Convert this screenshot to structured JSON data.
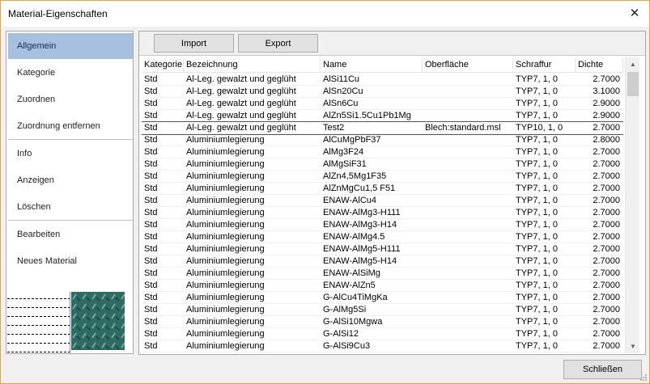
{
  "window": {
    "title": "Material-Eigenschaften",
    "close_glyph": "✕"
  },
  "sidebar": {
    "items": [
      {
        "label": "Allgemein",
        "active": true
      },
      {
        "label": "Kategorie"
      },
      {
        "label": "Zuordnen"
      },
      {
        "label": "Zuordnung entfernen"
      },
      {
        "label": "Info"
      },
      {
        "label": "Anzeigen"
      },
      {
        "label": "Löschen"
      },
      {
        "label": "Bearbeiten"
      },
      {
        "label": "Neues Material"
      }
    ]
  },
  "toolbar": {
    "import_label": "Import",
    "export_label": "Export"
  },
  "table": {
    "columns": [
      "Kategorie",
      "Bezeichnung",
      "Name",
      "Oberfläche",
      "Schraffur",
      "Dichte"
    ],
    "rows": [
      [
        "Std",
        "Al-Leg. gewalzt und geglüht",
        "AlSi11Cu",
        "",
        "TYP7, 1, 0",
        "2.7000"
      ],
      [
        "Std",
        "Al-Leg. gewalzt und geglüht",
        "AlSn20Cu",
        "",
        "TYP7, 1, 0",
        "3.1000"
      ],
      [
        "Std",
        "Al-Leg. gewalzt und geglüht",
        "AlSn6Cu",
        "",
        "TYP7, 1, 0",
        "2.9000"
      ],
      [
        "Std",
        "Al-Leg. gewalzt und geglüht",
        "AlZn5Si1.5Cu1Pb1Mg",
        "",
        "TYP7, 1, 0",
        "2.9000"
      ],
      [
        "Std",
        "Al-Leg. gewalzt und geglüht",
        "Test2",
        "Blech:standard.msl",
        "TYP10, 1, 0",
        "2.7000"
      ],
      [
        "Std",
        "Aluminiumlegierung",
        "AlCuMgPbF37",
        "",
        "TYP7, 1, 0",
        "2.8000"
      ],
      [
        "Std",
        "Aluminiumlegierung",
        "AlMg3F24",
        "",
        "TYP7, 1, 0",
        "2.7000"
      ],
      [
        "Std",
        "Aluminiumlegierung",
        "AlMgSiF31",
        "",
        "TYP7, 1, 0",
        "2.7000"
      ],
      [
        "Std",
        "Aluminiumlegierung",
        "AlZn4,5Mg1F35",
        "",
        "TYP7, 1, 0",
        "2.7000"
      ],
      [
        "Std",
        "Aluminiumlegierung",
        "AlZnMgCu1,5 F51",
        "",
        "TYP7, 1, 0",
        "2.7000"
      ],
      [
        "Std",
        "Aluminiumlegierung",
        "ENAW-AlCu4",
        "",
        "TYP7, 1, 0",
        "2.7000"
      ],
      [
        "Std",
        "Aluminiumlegierung",
        "ENAW-AlMg3-H111",
        "",
        "TYP7, 1, 0",
        "2.7000"
      ],
      [
        "Std",
        "Aluminiumlegierung",
        "ENAW-AlMg3-H14",
        "",
        "TYP7, 1, 0",
        "2.7000"
      ],
      [
        "Std",
        "Aluminiumlegierung",
        "ENAW-AlMg4.5",
        "",
        "TYP7, 1, 0",
        "2.7000"
      ],
      [
        "Std",
        "Aluminiumlegierung",
        "ENAW-AlMg5-H111",
        "",
        "TYP7, 1, 0",
        "2.7000"
      ],
      [
        "Std",
        "Aluminiumlegierung",
        "ENAW-AlMg5-H14",
        "",
        "TYP7, 1, 0",
        "2.7000"
      ],
      [
        "Std",
        "Aluminiumlegierung",
        "ENAW-AlSiMg",
        "",
        "TYP7, 1, 0",
        "2.7000"
      ],
      [
        "Std",
        "Aluminiumlegierung",
        "ENAW-AlZn5",
        "",
        "TYP7, 1, 0",
        "2.7000"
      ],
      [
        "Std",
        "Aluminiumlegierung",
        "G-AlCu4TiMgKa",
        "",
        "TYP7, 1, 0",
        "2.7000"
      ],
      [
        "Std",
        "Aluminiumlegierung",
        "G-AlMg5Si",
        "",
        "TYP7, 1, 0",
        "2.7000"
      ],
      [
        "Std",
        "Aluminiumlegierung",
        "G-AlSi10Mgwa",
        "",
        "TYP7, 1, 0",
        "2.7000"
      ],
      [
        "Std",
        "Aluminiumlegierung",
        "G-AlSi12",
        "",
        "TYP7, 1, 0",
        "2.7000"
      ],
      [
        "Std",
        "Aluminiumlegierung",
        "G-AlSi9Cu3",
        "",
        "TYP7, 1, 0",
        "2.7000"
      ]
    ],
    "selected_row": 4
  },
  "footer": {
    "close_label": "Schließen"
  },
  "colors": {
    "accent": "#a7c0df",
    "window_border": "#e7a33b",
    "pattern_fill": "#2f6b63"
  }
}
